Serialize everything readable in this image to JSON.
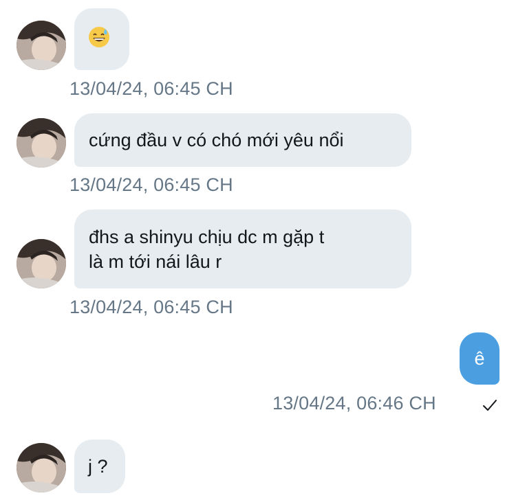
{
  "messages": [
    {
      "id": "m1",
      "direction": "incoming",
      "icon": "grinning-sweat-emoji",
      "text": "😅",
      "timestamp": "13/04/24, 06:45 CH"
    },
    {
      "id": "m2",
      "direction": "incoming",
      "text": "cứng đầu v có chó mới yêu nổi",
      "timestamp": "13/04/24, 06:45 CH"
    },
    {
      "id": "m3",
      "direction": "incoming",
      "lines": [
        "đhs a shinyu chịu dc m gặp t",
        "là m tới nái lâu r"
      ],
      "timestamp": "13/04/24, 06:45 CH"
    },
    {
      "id": "m4",
      "direction": "outgoing",
      "text": "ê",
      "timestamp": "13/04/24, 06:46 CH",
      "status_icon": "checkmark-icon"
    },
    {
      "id": "m5",
      "direction": "incoming",
      "text": "j ?"
    }
  ],
  "colors": {
    "incoming_bubble": "#e6ecf0",
    "outgoing_bubble": "#4b9fe1",
    "timestamp": "#657786"
  }
}
